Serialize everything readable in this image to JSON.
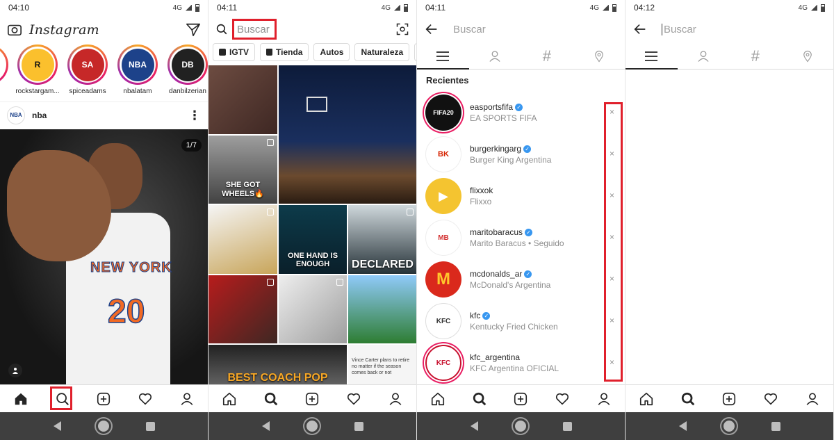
{
  "status_times": [
    "04:10",
    "04:11",
    "04:11",
    "04:12"
  ],
  "status_net": "4G",
  "colors": {
    "highlight": "#e0202c",
    "verified": "#3897f0",
    "story_ring": "#e91e63"
  },
  "feed": {
    "app_title": "Instagram",
    "stories": [
      {
        "name": "rockstargam...",
        "initials": "R",
        "color": "#fbc02d"
      },
      {
        "name": "spiceadams",
        "initials": "SA",
        "color": "#c62828"
      },
      {
        "name": "nbalatam",
        "initials": "NBA",
        "color": "#1d428a"
      },
      {
        "name": "danbilzerian",
        "initials": "DB",
        "color": "#212121"
      }
    ],
    "post": {
      "user": "nba",
      "avatar": "NBA",
      "counter": "1/7",
      "jersey_text": "NEW YORK",
      "jersey_number": "20"
    }
  },
  "explore": {
    "search_placeholder": "Buscar",
    "chips": [
      "IGTV",
      "Tienda",
      "Autos",
      "Naturaleza",
      "C"
    ],
    "tiles": [
      "",
      "",
      "SHE GOT WHEELS🔥",
      "",
      "ONE HAND IS ENOUGH",
      "DECLARED",
      "",
      "",
      "",
      "BEST COACH POP",
      "Vince Carter plans to retire no matter if the season comes back or not"
    ]
  },
  "recent": {
    "search_placeholder": "Buscar",
    "section_title": "Recientes",
    "close_glyph": "×",
    "items": [
      {
        "name": "easportsfifa",
        "subtitle": "EA SPORTS FIFA",
        "avatar": "FIFA20",
        "color": "#111111",
        "verified": true
      },
      {
        "name": "burgerkingarg",
        "subtitle": "Burger King Argentina",
        "avatar": "BK",
        "color": "#f5a623",
        "verified": true
      },
      {
        "name": "flixxok",
        "subtitle": "Flixxo",
        "avatar": "▶",
        "color": "#f4c430",
        "verified": false
      },
      {
        "name": "maritobaracus",
        "subtitle": "Marito Baracus • Seguido",
        "avatar": "MB",
        "color": "#d32f2f",
        "verified": true
      },
      {
        "name": "mcdonalds_ar",
        "subtitle": "McDonald's Argentina",
        "avatar": "M",
        "color": "#da291c",
        "verified": true
      },
      {
        "name": "kfc",
        "subtitle": "Kentucky Fried Chicken",
        "avatar": "KFC",
        "color": "#8d8d8d",
        "verified": true
      },
      {
        "name": "kfc_argentina",
        "subtitle": "KFC Argentina OFICIAL",
        "avatar": "KFC",
        "color": "#c8102e",
        "verified": false
      }
    ]
  },
  "empty_search": {
    "search_placeholder": "Buscar"
  }
}
